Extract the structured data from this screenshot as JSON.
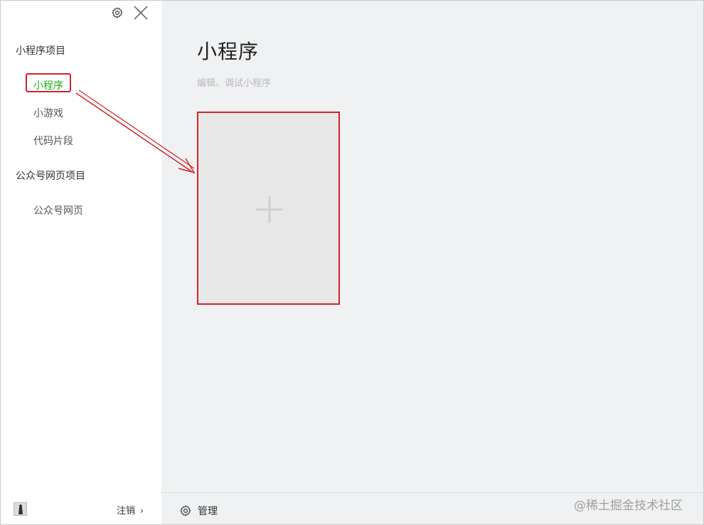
{
  "sidebar": {
    "sections": [
      {
        "title": "小程序项目",
        "items": [
          {
            "label": "小程序",
            "active": true
          },
          {
            "label": "小游戏",
            "active": false
          },
          {
            "label": "代码片段",
            "active": false
          }
        ]
      },
      {
        "title": "公众号网页项目",
        "items": [
          {
            "label": "公众号网页",
            "active": false
          }
        ]
      }
    ],
    "icons": {
      "settings": "gear-icon",
      "close": "close-icon"
    },
    "footer": {
      "logout_label": "注销",
      "chevron": "›"
    }
  },
  "main": {
    "title": "小程序",
    "subtitle": "编辑、调试小程序",
    "new_card_icon": "plus-icon",
    "bottom_bar": {
      "manage_label": "管理"
    },
    "watermark": "@稀土掘金技术社区"
  },
  "colors": {
    "accent_green": "#1aad19",
    "highlight_red": "#d0232b",
    "sidebar_bg": "#ffffff",
    "main_bg": "#f0f1f3"
  }
}
